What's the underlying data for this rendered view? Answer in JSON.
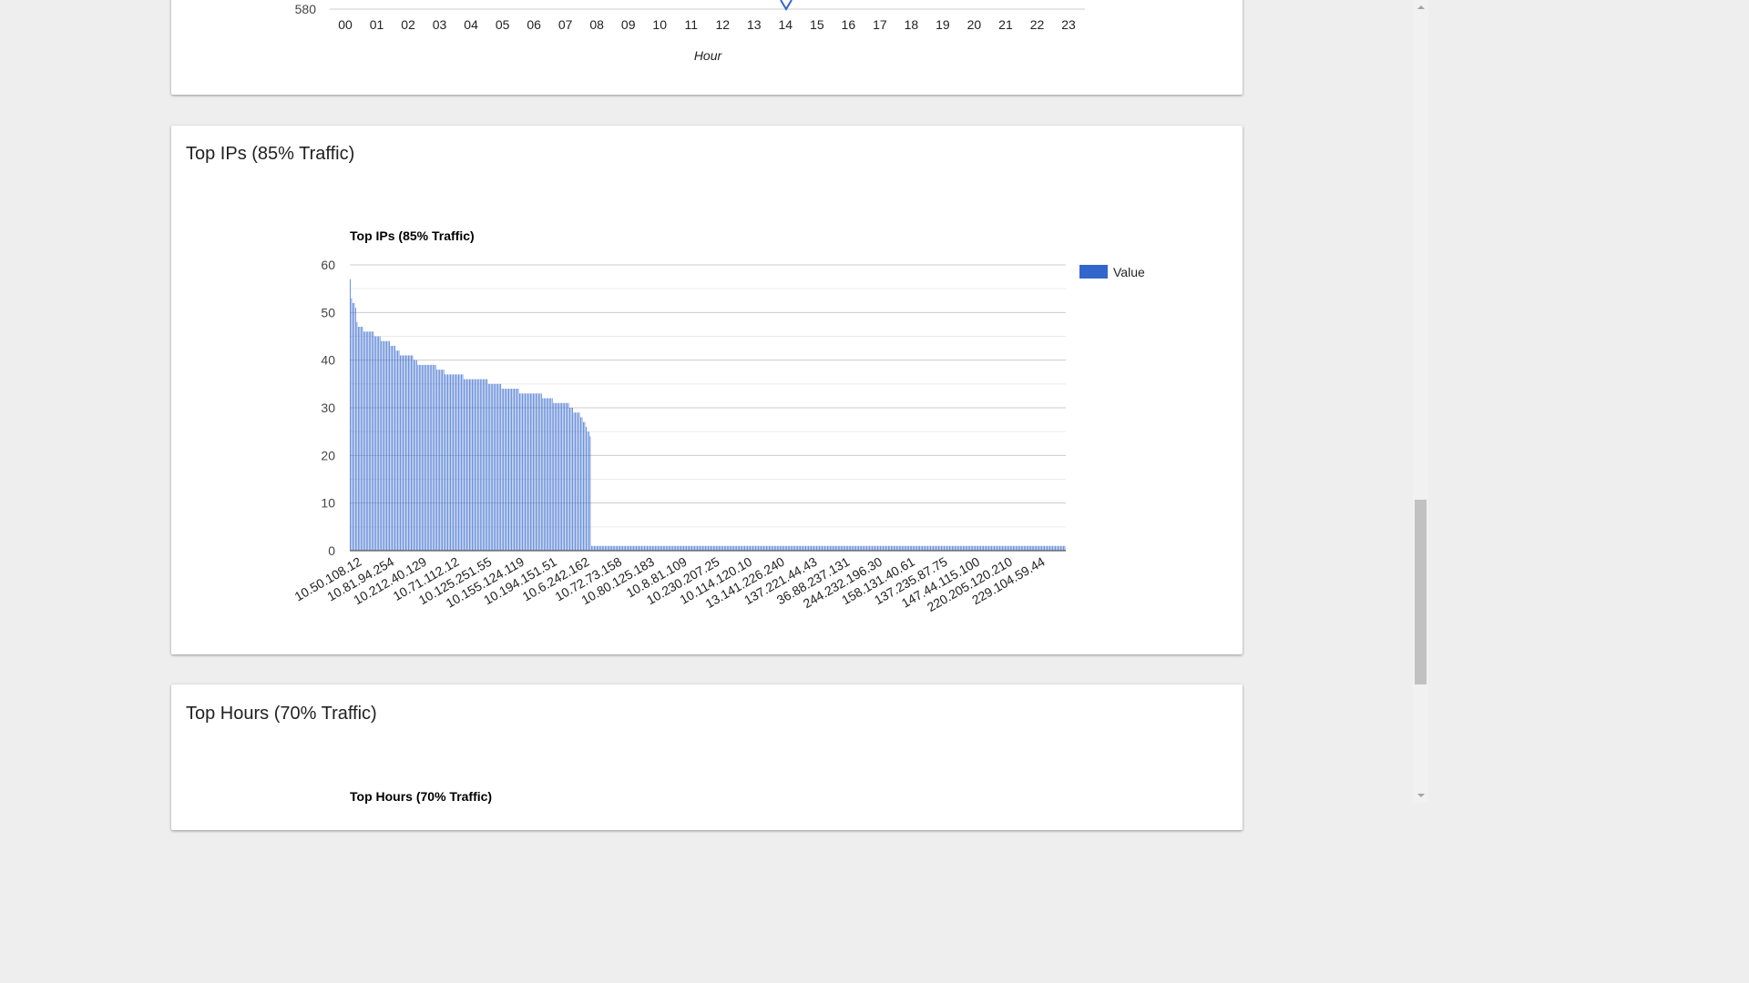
{
  "hourly_chart": {
    "chart_data": {
      "type": "line",
      "ytick_visible": "580",
      "categories": [
        "00",
        "01",
        "02",
        "03",
        "04",
        "05",
        "06",
        "07",
        "08",
        "09",
        "10",
        "11",
        "12",
        "13",
        "14",
        "15",
        "16",
        "17",
        "18",
        "19",
        "20",
        "21",
        "22",
        "23"
      ],
      "xlabel": "Hour",
      "series_color": "#3366cc"
    }
  },
  "top_ips": {
    "card_title": "Top IPs (85% Traffic)",
    "chart_data": {
      "type": "bar",
      "title": "Top IPs (85% Traffic)",
      "series": [
        {
          "name": "Value",
          "color": "#3366cc"
        }
      ],
      "legend": "right",
      "ylim": [
        0,
        60
      ],
      "yticks": [
        "60",
        "50",
        "40",
        "30",
        "20",
        "10",
        "0"
      ],
      "category_labels": [
        "10.50.108.12",
        "10.81.94.254",
        "10.212.40.129",
        "10.71.112.12",
        "10.125.251.55",
        "10.155.124.119",
        "10.194.151.51",
        "10.6.242.162",
        "10.72.73.158",
        "10.80.125.183",
        "10.8.81.109",
        "10.230.207.25",
        "10.114.120.10",
        "13.141.226.240",
        "137.221.44.43",
        "36.88.237.131",
        "244.232.196.30",
        "158.131.40.61",
        "137.235.87.75",
        "147.44.115.100",
        "220.205.120.210",
        "229.104.59.44"
      ],
      "values": [
        57,
        53,
        52,
        52,
        51,
        48,
        47,
        47,
        47,
        47,
        46,
        46,
        46,
        46,
        46,
        46,
        46,
        46,
        45,
        45,
        45,
        45,
        45,
        44,
        44,
        44,
        44,
        44,
        44,
        44,
        43,
        43,
        43,
        43,
        42,
        42,
        42,
        41,
        41,
        41,
        41,
        41,
        41,
        41,
        41,
        41,
        41,
        40,
        40,
        40,
        39,
        39,
        39,
        39,
        39,
        39,
        39,
        39,
        39,
        39,
        39,
        39,
        39,
        39,
        38,
        38,
        38,
        38,
        38,
        38,
        37,
        37,
        37,
        37,
        37,
        37,
        37,
        37,
        37,
        37,
        37,
        37,
        37,
        37,
        36,
        36,
        36,
        36,
        36,
        36,
        36,
        36,
        36,
        36,
        36,
        36,
        36,
        36,
        36,
        36,
        36,
        36,
        35,
        35,
        35,
        35,
        35,
        35,
        35,
        35,
        35,
        35,
        34,
        34,
        34,
        34,
        34,
        34,
        34,
        34,
        34,
        34,
        34,
        34,
        34,
        33,
        33,
        33,
        33,
        33,
        33,
        33,
        33,
        33,
        33,
        33,
        33,
        33,
        33,
        33,
        33,
        33,
        32,
        32,
        32,
        32,
        32,
        32,
        32,
        32,
        31,
        31,
        31,
        31,
        31,
        31,
        31,
        31,
        31,
        31,
        31,
        31,
        30,
        30,
        30,
        29,
        29,
        29,
        29,
        29,
        28,
        28,
        27,
        27,
        26,
        25,
        25,
        24,
        1,
        1,
        1,
        1,
        1,
        1,
        1,
        1,
        1,
        1,
        1,
        1,
        1,
        1,
        1,
        1,
        1,
        1,
        1,
        1,
        1,
        1,
        1,
        1,
        1,
        1,
        1,
        1,
        1,
        1,
        1,
        1,
        1,
        1,
        1,
        1,
        1,
        1,
        1,
        1,
        1,
        1,
        1,
        1,
        1,
        1,
        1,
        1,
        1,
        1,
        1,
        1,
        1,
        1,
        1,
        1,
        1,
        1,
        1,
        1,
        1,
        1,
        1,
        1,
        1,
        1,
        1,
        1,
        1,
        1,
        1,
        1,
        1,
        1,
        1,
        1,
        1,
        1,
        1,
        1,
        1,
        1,
        1,
        1,
        1,
        1,
        1,
        1,
        1,
        1,
        1,
        1,
        1,
        1,
        1,
        1,
        1,
        1,
        1,
        1,
        1,
        1,
        1,
        1,
        1,
        1,
        1,
        1,
        1,
        1,
        1,
        1,
        1,
        1,
        1,
        1,
        1,
        1,
        1,
        1,
        1,
        1,
        1,
        1,
        1,
        1,
        1,
        1,
        1,
        1,
        1,
        1,
        1,
        1,
        1,
        1,
        1,
        1,
        1,
        1,
        1,
        1,
        1,
        1,
        1,
        1,
        1,
        1,
        1,
        1,
        1,
        1,
        1,
        1,
        1,
        1,
        1,
        1,
        1,
        1,
        1,
        1,
        1,
        1,
        1,
        1,
        1,
        1,
        1,
        1,
        1,
        1,
        1,
        1,
        1,
        1,
        1,
        1,
        1,
        1,
        1,
        1,
        1,
        1,
        1,
        1,
        1,
        1,
        1,
        1,
        1,
        1,
        1,
        1,
        1,
        1,
        1,
        1,
        1,
        1,
        1,
        1,
        1,
        1,
        1,
        1,
        1,
        1,
        1,
        1,
        1,
        1,
        1,
        1,
        1,
        1,
        1,
        1,
        1,
        1,
        1,
        1,
        1,
        1,
        1,
        1,
        1,
        1,
        1,
        1,
        1,
        1,
        1,
        1,
        1,
        1,
        1,
        1,
        1,
        1,
        1,
        1,
        1,
        1,
        1,
        1,
        1,
        1,
        1,
        1,
        1,
        1,
        1,
        1,
        1,
        1,
        1,
        1,
        1,
        1,
        1,
        1,
        1,
        1,
        1,
        1,
        1,
        1,
        1,
        1,
        1,
        1,
        1,
        1,
        1,
        1,
        1,
        1,
        1,
        1,
        1,
        1,
        1,
        1,
        1,
        1,
        1,
        1,
        1,
        1,
        1,
        1,
        1,
        1,
        1,
        1,
        1,
        1,
        1,
        1,
        1,
        1,
        1,
        1,
        1,
        1,
        1,
        1,
        1,
        1,
        1,
        1,
        1,
        1,
        1,
        1,
        1,
        1,
        1,
        1,
        1,
        1,
        1,
        1,
        1,
        1,
        1,
        1,
        1,
        1,
        1,
        1,
        1,
        1,
        1,
        1,
        1,
        1,
        1,
        1,
        1,
        1,
        1,
        1,
        1,
        1,
        1,
        1,
        1,
        1
      ]
    }
  },
  "top_hours": {
    "card_title": "Top Hours (70% Traffic)",
    "chart_title": "Top Hours (70% Traffic)"
  }
}
